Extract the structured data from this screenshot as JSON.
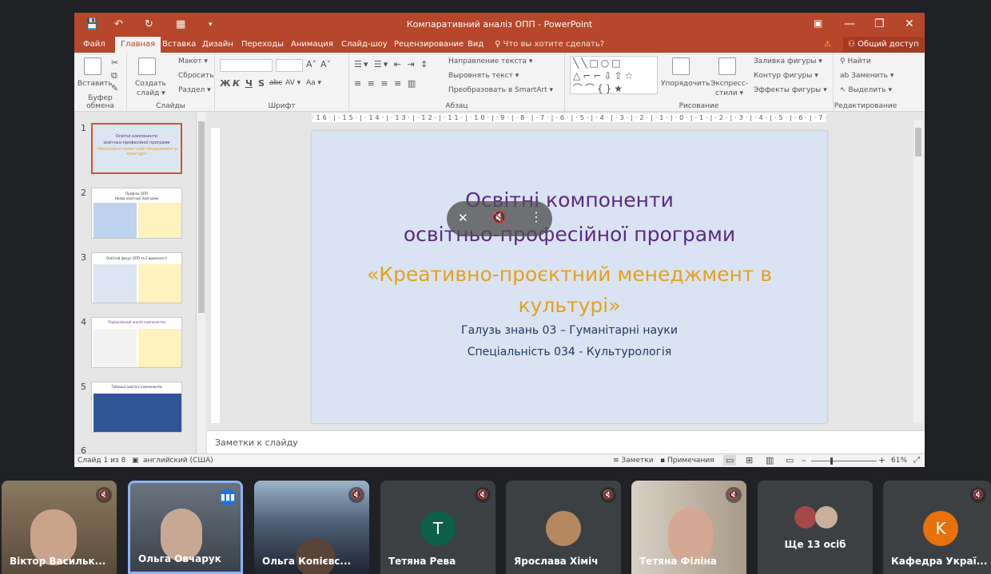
{
  "window": {
    "title": "Компаративний аналіз ОПП - PowerPoint",
    "quick_access": [
      "💾",
      "↶",
      "↻",
      "▦",
      "▾"
    ],
    "window_controls": [
      "▣",
      "—",
      "❐",
      "✕"
    ]
  },
  "tabs": [
    {
      "label": "Файл"
    },
    {
      "label": "Главная"
    },
    {
      "label": "Вставка"
    },
    {
      "label": "Дизайн"
    },
    {
      "label": "Переходы"
    },
    {
      "label": "Анимация"
    },
    {
      "label": "Слайд-шоу"
    },
    {
      "label": "Рецензирование"
    },
    {
      "label": "Вид"
    },
    {
      "label": "♀ Что вы хотите сделать?"
    }
  ],
  "share_label": "Общий доступ",
  "ribbon": {
    "clipboard": {
      "group": "Буфер обмена",
      "paste": "Вставить"
    },
    "slides": {
      "group": "Слайды",
      "new_slide": "Создать",
      "new_slide2": "слайд ▾",
      "layout": "Макет ▾",
      "reset": "Сбросить",
      "section": "Раздел ▾"
    },
    "font": {
      "group": "Шрифт",
      "bold": "Ж",
      "italic": "К",
      "underline": "Ч",
      "shadow": "S",
      "strike": "abc",
      "spacing": "AV ▾",
      "case": "Aa ▾",
      "grow": "A˄",
      "shrink": "A˅"
    },
    "paragraph": {
      "group": "Абзац",
      "text_dir": "Направление текста ▾",
      "align_text": "Выровнять текст ▾",
      "smartart": "Преобразовать в SmartArt ▾"
    },
    "drawing": {
      "group": "Рисование",
      "arrange": "Упорядочить",
      "quick_styles": "Экспресс-",
      "quick_styles2": "стили ▾",
      "fill": "Заливка фигуры ▾",
      "outline": "Контур фигуры ▾",
      "effects": "Эффекты фигуры ▾"
    },
    "editing": {
      "group": "Редактирование",
      "find": "Найти",
      "replace": "Заменить ▾",
      "select": "Выделить ▾"
    }
  },
  "thumbnails": [
    {
      "num": "1",
      "t1": "Освітні компоненти",
      "t2": "освітньо-професійної програми",
      "t3": "«Креативно-проєктний менеджмент в культурі»"
    },
    {
      "num": "2",
      "t1": "Профіль ОПП",
      "t2": "Назва освітньої програми"
    },
    {
      "num": "3",
      "t1": "Освітній фокус ОПП та її відмінності"
    },
    {
      "num": "4",
      "t1": "Порівняльний аналіз компонентів"
    },
    {
      "num": "5",
      "t1": "Таблиця освітніх компонентів"
    },
    {
      "num": "6"
    }
  ],
  "ruler_h": "·16·|·15·|·14·|·13·|·12·|·11·|·10·|·9·|·8·|·7·|·6·|·5·|·4·|·3·|·2·|·1·|·0·|·1·|·2·|·3·|·4·|·5·|·6·|·7·|·8·|·9·|·10·|·11·|·12·|·13·|·14·|·15·|·16·",
  "slide": {
    "title1": "Освітні компоненти",
    "title2": "освітньо-професійної програми",
    "title3": "«Креативно-проєктний менеджмент в культурі»",
    "line1": "Галузь знань 03 – Гуманітарні науки",
    "line2": "Спеціальність 034 - Культурологія"
  },
  "notes_placeholder": "Заметки к слайду",
  "status": {
    "slide": "Слайд 1 из 8",
    "lang": "английский (США)",
    "notes_btn": "≡ Заметки",
    "comments_btn": "▪ Примечания",
    "zoom_minus": "–",
    "zoom_plus": "+",
    "zoom": "61%",
    "zoom_level": 0.61
  },
  "participants": [
    {
      "name": "Віктор Васильк...",
      "initial": "",
      "color": "#6a5a48"
    },
    {
      "name": "Ольга Овчарук",
      "initial": "",
      "color": "#5b6470"
    },
    {
      "name": "Ольга Копієвс...",
      "initial": "",
      "color": "#2c3440"
    },
    {
      "name": "Тетяна Рева",
      "initial": "T",
      "color": "#0b5f4b"
    },
    {
      "name": "Ярослава Хіміч",
      "initial": "",
      "color": "#b58860"
    },
    {
      "name": "Тетяна Філіна",
      "initial": "",
      "color": "#8d7a6a"
    },
    {
      "name": "Ще 13 осіб",
      "initial": "",
      "color": "#a54848"
    },
    {
      "name": "Кафедра Украї...",
      "initial": "K",
      "color": "#e8710a"
    }
  ],
  "colors": {
    "accent": "#b7472a",
    "title_purple": "#5b2a86",
    "title_gold": "#e3a21a",
    "speaking": "#8ab4f8"
  }
}
